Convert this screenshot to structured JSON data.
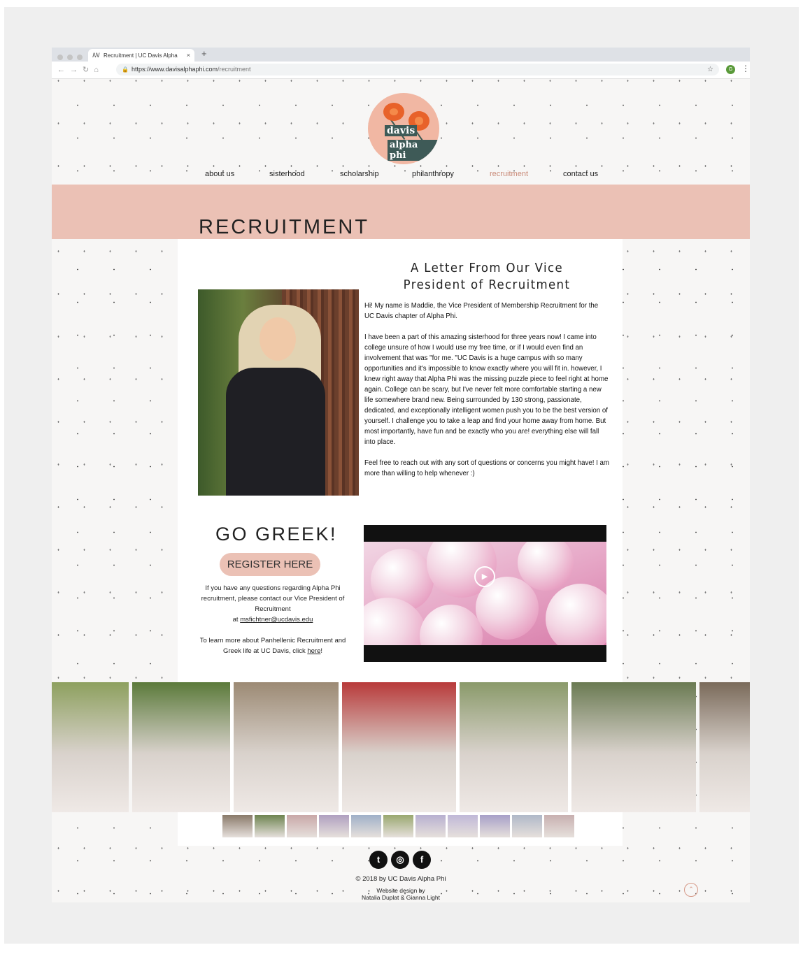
{
  "browser": {
    "tab_title": "Recruitment | UC Davis Alpha",
    "tab_close": "×",
    "new_tab": "+",
    "url_host": "https://www.davisalphaphi.com",
    "url_path": "/recruitment",
    "profile_initial": "G"
  },
  "logo": {
    "line1": "davis",
    "line2": "alpha phi"
  },
  "nav": {
    "items": [
      {
        "label": "about us"
      },
      {
        "label": "sisterhood"
      },
      {
        "label": "scholarship"
      },
      {
        "label": "philanthropy"
      },
      {
        "label": "recruitment",
        "active": true
      },
      {
        "label": "contact us"
      }
    ]
  },
  "banner": {
    "title": "RECRUITMENT"
  },
  "letter": {
    "title_line1": "A Letter From Our Vice",
    "title_line2": "President of Recruitment",
    "paragraphs": [
      "Hi! My name is Maddie, the Vice President of Membership Recruitment for the UC Davis chapter of Alpha Phi.",
      "I have been a part of this amazing sisterhood for three years now! I came into college unsure of how I would use my free time, or if I would even find an involvement that was \"for me. \"UC Davis is a huge campus with so many opportunities and it's impossible to know exactly where you will fit in. however,  I knew right away that Alpha Phi was the missing puzzle piece to feel right at home again. College can be scary, but I've never felt more comfortable starting a new life somewhere brand new. Being surrounded by 130 strong, passionate, dedicated, and exceptionally intelligent women push you to be the best version of yourself. I challenge you to take a leap and find your home away from home. But most importantly, have fun and be exactly who you are! everything else will fall into place.",
      "Feel free to reach out with any sort of questions or concerns you might have! I am more than willing to help whenever :)"
    ]
  },
  "go_greek": {
    "heading": "GO GREEK!",
    "register_label": "REGISTER HERE",
    "contact_prefix": "If you have any questions regarding Alpha Phi recruitment, please contact our Vice President of Recruitment",
    "contact_at": "at",
    "contact_email": "msfichtner@ucdavis.edu",
    "learn_prefix": "To learn more about Panhellenic Recruitment and Greek life at UC Davis, click",
    "learn_link": "here",
    "learn_suffix": "!"
  },
  "video": {
    "play_icon": "▶"
  },
  "gallery": {
    "photos": [
      {
        "color": "#8da05e"
      },
      {
        "color": "#5b7a3a"
      },
      {
        "color": "#9c8a74"
      },
      {
        "color": "#b83a3a"
      },
      {
        "color": "#8a9a6a"
      },
      {
        "color": "#6a7a52"
      },
      {
        "color": "#7a6a5a"
      }
    ],
    "thumbs": [
      "#8a7a6a",
      "#6e8450",
      "#c9a8a8",
      "#b0a0c0",
      "#a0b0c8",
      "#9aa870",
      "#b8b0d0",
      "#c0b8d8",
      "#a8a0c8",
      "#b0b8c8",
      "#c8b0b0"
    ]
  },
  "footer": {
    "social": [
      "t",
      "◎",
      "f"
    ],
    "copyright": "© 2018 by UC Davis Alpha Phi",
    "credit_line1": "Website design by",
    "credit_line2": "Natalia Duplat & Gianna Light",
    "back_to_top": "⌃"
  }
}
